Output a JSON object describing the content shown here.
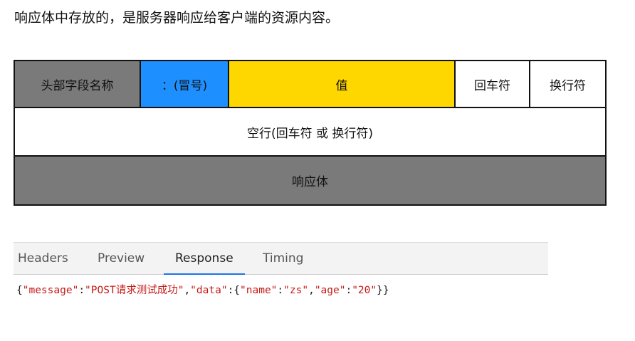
{
  "intro_text": "响应体中存放的，是服务器响应给客户端的资源内容。",
  "diagram": {
    "row1": {
      "field_name": "头部字段名称",
      "colon": "：(冒号)",
      "value": "值",
      "carriage_return": "回车符",
      "line_feed": "换行符"
    },
    "row2": "空行(回车符 或 换行符)",
    "row3": "响应体",
    "colors": {
      "gray": "#7a7a7a",
      "blue": "#1e8fff",
      "yellow": "#ffd700",
      "white": "#ffffff"
    }
  },
  "devtools": {
    "tabs": [
      "Headers",
      "Preview",
      "Response",
      "Timing"
    ],
    "active_tab": "Response",
    "accent": "#1a73e8",
    "response_json": {
      "open": "{",
      "k_message": "\"message\"",
      "colon1": ":",
      "v_message_prefix": "\"POST",
      "v_message_cn": "请求测试成功",
      "v_message_suffix": "\"",
      "comma1": ",",
      "k_data": "\"data\"",
      "colon2": ":{",
      "k_name": "\"name\"",
      "colon3": ":",
      "v_name": "\"zs\"",
      "comma2": ",",
      "k_age": "\"age\"",
      "colon4": ":",
      "v_age": "\"20\"",
      "close": "}}"
    },
    "string_color": "#c41a16"
  }
}
